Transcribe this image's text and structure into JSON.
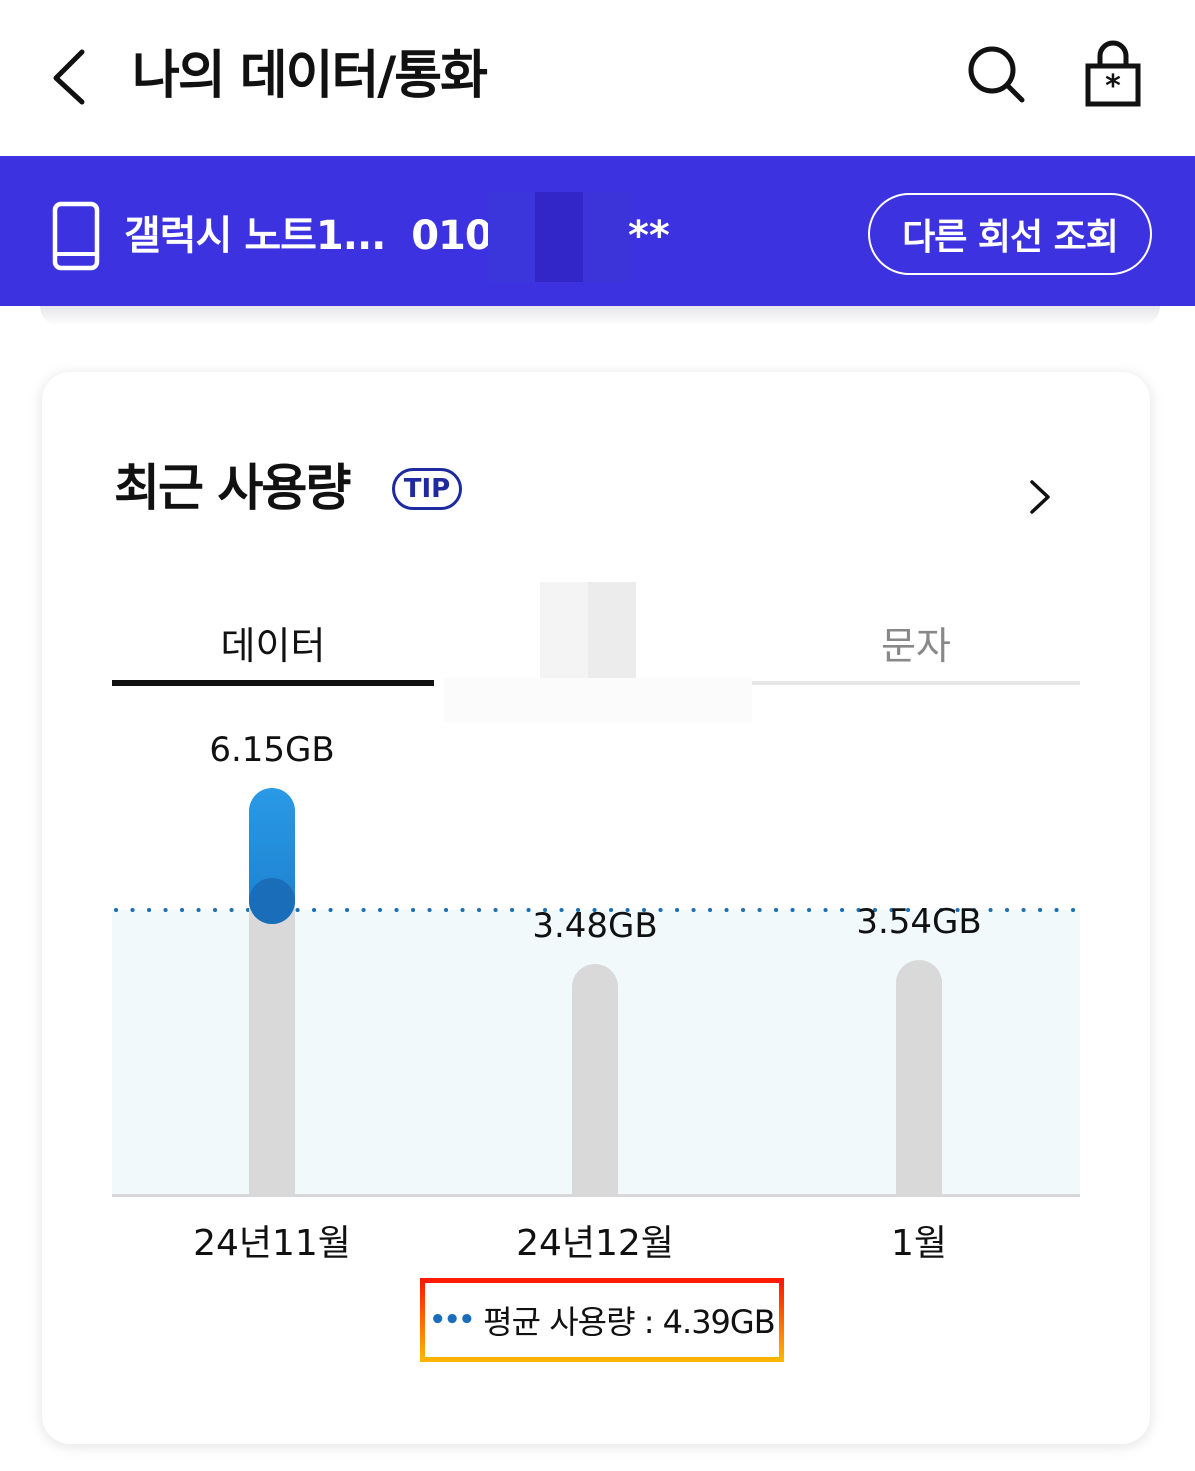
{
  "header": {
    "title": "나의 데이터/통화"
  },
  "line": {
    "device_name": "갤럭시 노트1...",
    "number_prefix": "010-",
    "number_suffix": "**",
    "other_line_button": "다른 회선 조회"
  },
  "usage_card": {
    "title": "최근 사용량",
    "tip_badge": "TIP",
    "tabs": [
      {
        "label": "데이터",
        "selected": true
      },
      {
        "label": "",
        "selected": false
      },
      {
        "label": "문자",
        "selected": false
      }
    ],
    "average_label": "평균 사용량 : 4.39GB"
  },
  "colors": {
    "accent": "#3d32e0",
    "bar_highlight": "#1c7fce",
    "bar_track": "#d9d9d9",
    "legend_border_top": "#ff1a00",
    "legend_border_bottom": "#ffb300"
  },
  "chart_data": {
    "type": "bar",
    "categories": [
      "24년11월",
      "24년12월",
      "1월"
    ],
    "values": [
      6.15,
      3.48,
      3.54
    ],
    "value_labels": [
      "6.15GB",
      "3.48GB",
      "3.54GB"
    ],
    "unit": "GB",
    "average": 4.39,
    "highlighted_index": 0,
    "ylim": [
      0,
      7.3
    ]
  }
}
